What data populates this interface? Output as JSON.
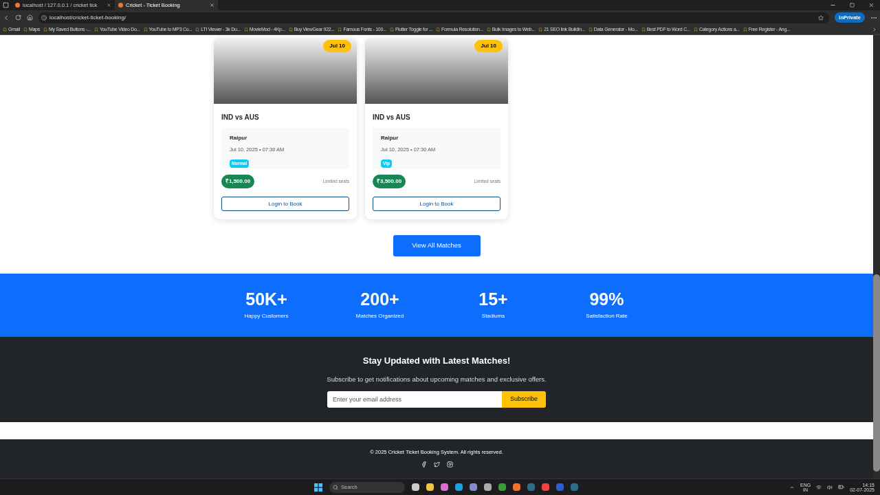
{
  "browser": {
    "tabs": [
      {
        "title": "localhost / 127.0.0.1 / cricket tick",
        "selected": false
      },
      {
        "title": "Cricket - Ticket Booking",
        "selected": true
      }
    ],
    "address": "localhost/cricket-ticket-booking/",
    "profile": "InPrivate",
    "bookmarks": [
      "Gmail",
      "Maps",
      "My Saved Buttons -...",
      "YouTube Video Do...",
      "YouTube to MP3 Co...",
      "LTI Viewer - 3k Du...",
      "MovieMod - 4Kp...",
      "Buy ViewGear 922...",
      "Famous Fonts - 100...",
      "Flutter Toggle for ...",
      "Formula Resolution...",
      "Bulk Images to Web...",
      "21 SEO link Buildin...",
      "Data Generator - Mo...",
      "Best PDF to Word C...",
      "Category Actions a...",
      "Free Register - Ang..."
    ]
  },
  "matches": [
    {
      "date_badge": "Jul 10",
      "title": "IND vs AUS",
      "venue": "Raipur",
      "datetime": "Jul 10, 2025 • 07:30 AM",
      "category": "Normal",
      "price": "₹1,500.00",
      "seats_note": "Limited seats",
      "button": "Login to Book"
    },
    {
      "date_badge": "Jul 10",
      "title": "IND vs AUS",
      "venue": "Raipur",
      "datetime": "Jul 10, 2025 • 07:30 AM",
      "category": "Vip",
      "price": "₹3,500.00",
      "seats_note": "Limited seats",
      "button": "Login to Book"
    }
  ],
  "view_all_button": "View All Matches",
  "stats": [
    {
      "value": "50K+",
      "label": "Happy Customers"
    },
    {
      "value": "200+",
      "label": "Matches Organized"
    },
    {
      "value": "15+",
      "label": "Stadiums"
    },
    {
      "value": "99%",
      "label": "Satisfaction Rate"
    }
  ],
  "newsletter": {
    "title": "Stay Updated with Latest Matches!",
    "text": "Subscribe to get notifications about upcoming matches and exclusive offers.",
    "placeholder": "Enter your email address",
    "button": "Subscribe"
  },
  "footer": {
    "copyright": "© 2025 Cricket Ticket Booking System. All rights reserved."
  },
  "taskbar": {
    "search_placeholder": "Search",
    "language": "ENG",
    "region": "IN",
    "time": "14:15",
    "date": "02-07-2025"
  }
}
